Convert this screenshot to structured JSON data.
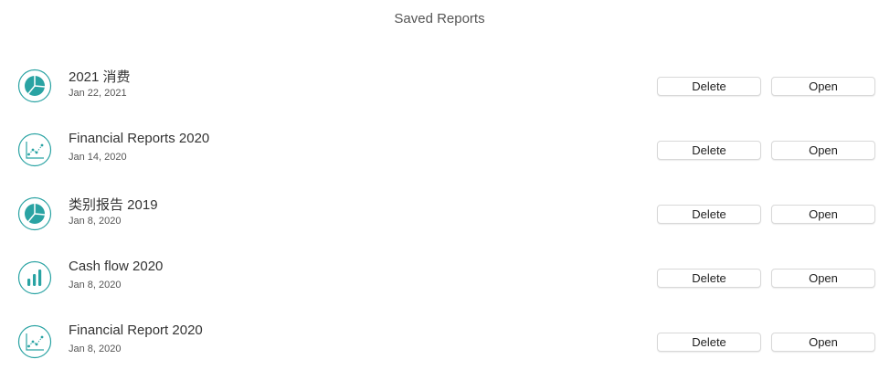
{
  "window": {
    "title": "Saved Reports"
  },
  "colors": {
    "icon_accent": "#2aa3a3",
    "icon_ring": "#2aa3a3"
  },
  "reports": [
    {
      "name": "2021 消费",
      "date": "Jan 22, 2021",
      "icon": "pie-chart-icon",
      "delete_label": "Delete",
      "open_label": "Open"
    },
    {
      "name": "Financial Reports 2020",
      "date": "Jan 14, 2020",
      "icon": "line-chart-icon",
      "delete_label": "Delete",
      "open_label": "Open"
    },
    {
      "name": "类别报告 2019",
      "date": "Jan 8, 2020",
      "icon": "pie-chart-icon",
      "delete_label": "Delete",
      "open_label": "Open"
    },
    {
      "name": "Cash flow 2020",
      "date": "Jan 8, 2020",
      "icon": "bar-chart-icon",
      "delete_label": "Delete",
      "open_label": "Open"
    },
    {
      "name": "Financial Report 2020",
      "date": "Jan 8, 2020",
      "icon": "line-chart-icon",
      "delete_label": "Delete",
      "open_label": "Open"
    }
  ]
}
